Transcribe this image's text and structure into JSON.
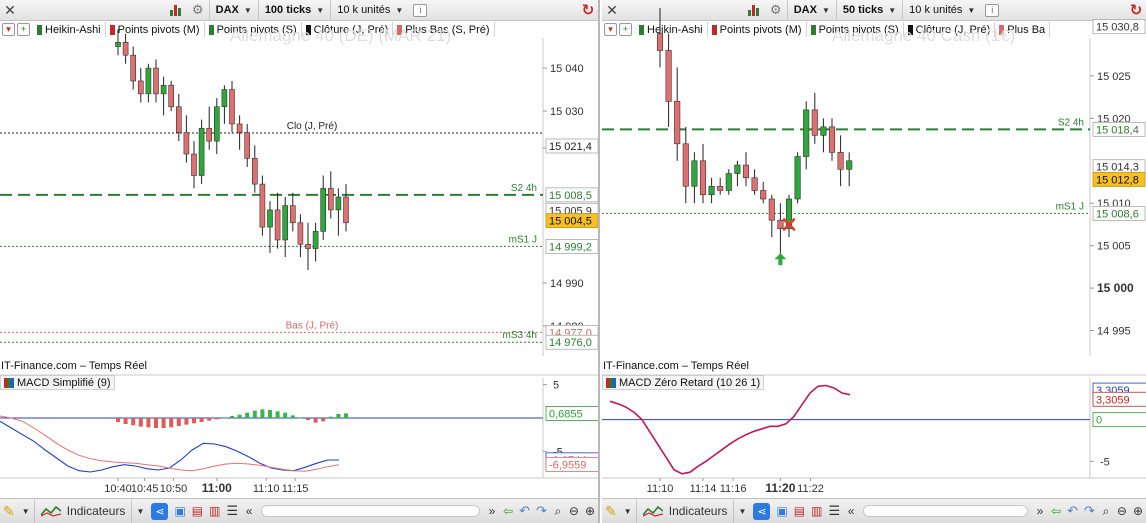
{
  "left": {
    "toolbar": {
      "instrument": "DAX",
      "interval": "100 ticks",
      "units": "10 k unités"
    },
    "indicators": [
      {
        "label": "Heikin-Ashi",
        "color": "#2e7d32"
      },
      {
        "label": "Points pivots (M)",
        "color": "#c62828"
      },
      {
        "label": "Points pivots (S)",
        "color": "#2e7d32"
      },
      {
        "label": "Clôture (J, Pré)",
        "color": "#111111"
      },
      {
        "label": "Plus Bas (S, Pré)",
        "color": "#d46a6a"
      }
    ],
    "watermark": "Allemagne 40 (DE) (MAR 21)",
    "price_axis": {
      "ticks": [
        "15 040",
        "15 030",
        "15 021,4",
        "14 990",
        "14 980"
      ],
      "tick_prices": [
        15040,
        15030,
        15021.4,
        14990,
        14980
      ],
      "range": [
        14973,
        15047
      ]
    },
    "levels": [
      {
        "id": "clo",
        "price": 15024.9,
        "style": "dotted",
        "color": "#222222",
        "label": "Clo (J, Pré)",
        "tag": "15 021,4",
        "tag_bg": "#ffffff",
        "tag_fg": "#222222"
      },
      {
        "id": "s2",
        "price": 15010.5,
        "style": "dashed",
        "color": "#2e7d32",
        "label": "S2 4h",
        "tag": "15 008,5",
        "tag_bg": "#ffffff",
        "tag_fg": "#2e7d32"
      },
      {
        "id": "ms1",
        "price": 14998.5,
        "style": "dotted",
        "color": "#2e7d32",
        "label": "mS1 J",
        "tag": "14 999,2",
        "tag_bg": "#ffffff",
        "tag_fg": "#2e7d32"
      },
      {
        "id": "bas",
        "price": 14978.5,
        "style": "dotted",
        "color": "#d46a6a",
        "label": "Bas (J, Pré)",
        "tag": "14 977,0",
        "tag_bg": "#ffffff",
        "tag_fg": "#d46a6a"
      },
      {
        "id": "ms3",
        "price": 14976.2,
        "style": "dotted",
        "color": "#2e7d32",
        "label": "mS3 4h",
        "tag": "14 976,0",
        "tag_bg": "#ffffff",
        "tag_fg": "#2e7d32"
      }
    ],
    "price_tags": [
      {
        "text": "15 005,9",
        "price": 15006.9,
        "bg": "#ffffff",
        "fg": "#333333"
      },
      {
        "text": "15 004,5",
        "price": 15004.5,
        "bg": "#f5c026",
        "fg": "#111111"
      }
    ],
    "candles": [
      [
        15045,
        15049,
        15043,
        15046
      ],
      [
        15046,
        15048,
        15041,
        15043
      ],
      [
        15043,
        15045,
        15035,
        15037
      ],
      [
        15037,
        15040,
        15032,
        15034
      ],
      [
        15034,
        15041,
        15032,
        15040
      ],
      [
        15040,
        15042,
        15032,
        15034
      ],
      [
        15034,
        15038,
        15029,
        15036
      ],
      [
        15036,
        15037,
        15030,
        15031
      ],
      [
        15031,
        15034,
        15023,
        15025
      ],
      [
        15025,
        15029,
        15018,
        15020
      ],
      [
        15020,
        15023,
        15012,
        15015
      ],
      [
        15015,
        15028,
        15013,
        15026
      ],
      [
        15026,
        15031,
        15021,
        15023
      ],
      [
        15023,
        15033,
        15020,
        15031
      ],
      [
        15031,
        15036,
        15027,
        15035
      ],
      [
        15035,
        15037,
        15025,
        15027
      ],
      [
        15027,
        15029,
        15021,
        15025
      ],
      [
        15025,
        15027,
        15017,
        15019
      ],
      [
        15019,
        15022,
        15011,
        15013
      ],
      [
        15013,
        15015,
        15001,
        15003
      ],
      [
        15003,
        15009,
        14997,
        15007
      ],
      [
        15007,
        15011,
        14998,
        15000
      ],
      [
        15000,
        15010,
        14996,
        15008
      ],
      [
        15008,
        15011,
        15002,
        15004
      ],
      [
        15004,
        15006,
        14996,
        14999
      ],
      [
        14999,
        15004,
        14993,
        14998
      ],
      [
        14998,
        15004,
        14995,
        15002
      ],
      [
        15002,
        15015,
        15000,
        15012
      ],
      [
        15012,
        15016,
        15005,
        15007
      ],
      [
        15007,
        15012,
        15001,
        15010
      ],
      [
        15010,
        15013,
        15002,
        15004
      ]
    ],
    "times": [
      "10:40",
      "10:45",
      "10:50",
      "11:00",
      "11:10",
      "11:15"
    ],
    "time_pos": [
      0,
      3.5,
      7.3,
      13,
      19.5,
      23.3
    ],
    "bold_time": "11:00",
    "feed": "IT-Finance.com – Temps Réel",
    "macd": {
      "title": "MACD Simplifié (9)",
      "range": [
        -9,
        6
      ],
      "ticks": [
        "5",
        "-5"
      ],
      "tick_vals": [
        5,
        -5
      ],
      "tags": [
        {
          "text": "0,6855",
          "value": 0.6855,
          "color": "#2e9e3a"
        },
        {
          "text": "-6,2744",
          "value": -6.2744,
          "color": "#1e40c8"
        },
        {
          "text": "-6,9559",
          "value": -6.9559,
          "color": "#d46a6a"
        }
      ],
      "hist": [
        -0.6,
        -0.9,
        -1.1,
        -1.3,
        -1.4,
        -1.5,
        -1.5,
        -1.4,
        -1.2,
        -1.0,
        -0.8,
        -0.6,
        -0.4,
        -0.2,
        0.1,
        0.3,
        0.5,
        0.8,
        1.1,
        1.3,
        1.2,
        1.0,
        0.8,
        0.4,
        0.1,
        -0.3,
        -0.7,
        -0.5,
        0.2,
        0.6,
        0.7
      ],
      "macd_line": [
        -0.5,
        -1.5,
        -2.5,
        -3.5,
        -4.8,
        -6.0,
        -7.2,
        -7.9,
        -8.1,
        -7.8,
        -7.3,
        -7.0,
        -7.2,
        -7.6,
        -7.8,
        -7.5,
        -6.3,
        -4.8,
        -3.8,
        -3.9,
        -4.3,
        -5.0,
        -5.8,
        -6.8,
        -7.5,
        -7.8,
        -7.9,
        -7.4,
        -6.8,
        -6.3,
        -6.3
      ],
      "signal_line": [
        0.3,
        0.0,
        -0.5,
        -1.5,
        -2.6,
        -3.8,
        -4.8,
        -5.6,
        -6.1,
        -6.4,
        -6.6,
        -6.7,
        -6.8,
        -7.0,
        -7.2,
        -7.5,
        -7.8,
        -7.9,
        -7.6,
        -7.2,
        -6.9,
        -6.8,
        -6.9,
        -7.1,
        -7.4,
        -7.7,
        -7.9,
        -8.0,
        -7.7,
        -7.3,
        -7.0
      ],
      "zero_color": "#2a3fbd"
    }
  },
  "right": {
    "toolbar": {
      "instrument": "DAX",
      "interval": "50 ticks",
      "units": "10 k unités"
    },
    "indicators": [
      {
        "label": "Heikin-Ashi",
        "color": "#2e7d32"
      },
      {
        "label": "Points pivots (M)",
        "color": "#c62828"
      },
      {
        "label": "Points pivots (S)",
        "color": "#2e7d32"
      },
      {
        "label": "Clôture (J, Pré)",
        "color": "#111111"
      },
      {
        "label": "Plus Ba",
        "color": "#d46a6a"
      }
    ],
    "watermark": "Allemagne 40 Cash (1€)",
    "price_axis": {
      "ticks": [
        "15 025",
        "15 020",
        "15 010",
        "15 005",
        "15 000",
        "14 995"
      ],
      "tick_prices": [
        15025,
        15020,
        15010,
        15005,
        15000,
        14995
      ],
      "bold_tick": "15 000",
      "range": [
        14992,
        15031
      ]
    },
    "top_tag": {
      "text": "15 030,8",
      "price": 15030.8
    },
    "levels": [
      {
        "id": "s2",
        "price": 15018.7,
        "style": "dashed",
        "color": "#2e7d32",
        "label": "S2 4h",
        "tag": "15 018,4",
        "tag_bg": "#ffffff",
        "tag_fg": "#2e7d32"
      },
      {
        "id": "ms1",
        "price": 15008.8,
        "style": "dotted",
        "color": "#2e7d32",
        "label": "mS1 J",
        "tag": "15 008,6",
        "tag_bg": "#ffffff",
        "tag_fg": "#2e7d32"
      }
    ],
    "price_tags": [
      {
        "text": "15 014,3",
        "price": 15014.3,
        "bg": "#ffffff",
        "fg": "#333333"
      },
      {
        "text": "15 012,8",
        "price": 15012.8,
        "bg": "#f5c026",
        "fg": "#111111"
      }
    ],
    "candles": [
      [
        15030,
        15033,
        15026,
        15028
      ],
      [
        15028,
        15030,
        15019,
        15022
      ],
      [
        15022,
        15026,
        15015,
        15017
      ],
      [
        15017,
        15019,
        15010,
        15012
      ],
      [
        15012,
        15016,
        15010,
        15015
      ],
      [
        15015,
        15017,
        15010,
        15011
      ],
      [
        15011,
        15013,
        15010,
        15012
      ],
      [
        15012,
        15013,
        15011,
        15011.5
      ],
      [
        15011.5,
        15014,
        15011,
        15013.5
      ],
      [
        15013.5,
        15015,
        15012,
        15014.5
      ],
      [
        15014.5,
        15016,
        15012,
        15013
      ],
      [
        15013,
        15014,
        15011,
        15011.5
      ],
      [
        15011.5,
        15012.5,
        15010,
        15010.5
      ],
      [
        15010.5,
        15011,
        15006,
        15008
      ],
      [
        15008,
        15010,
        15004,
        15007
      ],
      [
        15007,
        15011,
        15006,
        15010.5
      ],
      [
        15010.5,
        15016,
        15010,
        15015.5
      ],
      [
        15015.5,
        15022,
        15014,
        15021
      ],
      [
        15021,
        15023,
        15017,
        15018
      ],
      [
        15018,
        15020,
        15016,
        15019
      ],
      [
        15019,
        15020,
        15015,
        15016
      ],
      [
        15016,
        15018,
        15012,
        15014
      ],
      [
        15014,
        15016,
        15012,
        15015
      ]
    ],
    "markers": [
      {
        "type": "arrow-up",
        "idx": 14,
        "price": 15003.4,
        "color": "#2eaa3f"
      },
      {
        "type": "cross",
        "idx": 15,
        "price": 15007.5,
        "color": "#e53935"
      }
    ],
    "times": [
      "11:10",
      "11:14",
      "11:16",
      "11:20",
      "11:22"
    ],
    "time_pos": [
      0,
      5,
      8.5,
      14,
      17.5
    ],
    "bold_time": "11:20",
    "feed": "IT-Finance.com – Temps Réel",
    "macd": {
      "title": "MACD Zéro Retard (10 26 1)",
      "range": [
        -7,
        5
      ],
      "ticks": [
        "-5"
      ],
      "tick_vals": [
        -5
      ],
      "tags": [
        {
          "text": "3,3059",
          "value": 3.55,
          "color": "#1e40c8"
        },
        {
          "text": "3,3059",
          "value": 2.45,
          "color": "#c62828"
        },
        {
          "text": "0",
          "value": 0,
          "color": "#2e9e3a"
        }
      ],
      "line": [
        2.2,
        1.9,
        1.5,
        0.9,
        0.0,
        -1.5,
        -3.0,
        -4.5,
        -6.0,
        -6.5,
        -6.3,
        -5.6,
        -5.0,
        -4.3,
        -3.6,
        -2.9,
        -2.3,
        -1.8,
        -1.4,
        -1.1,
        -0.8,
        -0.8,
        -0.5,
        0.4,
        1.8,
        3.2,
        4.0,
        4.1,
        3.8,
        3.2,
        3.0
      ],
      "line_color": "#c2185b",
      "zero_color": "#2a3fbd"
    }
  },
  "bottombar": {
    "indicators_label": "Indicateurs"
  }
}
